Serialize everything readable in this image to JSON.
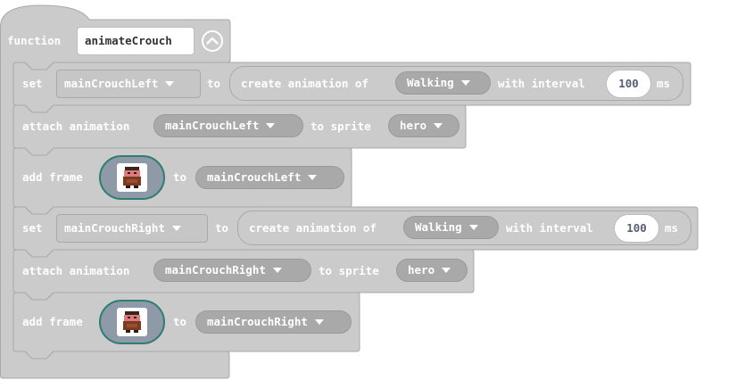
{
  "function_block": {
    "keyword": "function",
    "name": "animateCrouch",
    "collapse_icon": "chevron-up-circle-icon",
    "color": "#cbcbcb"
  },
  "blocks": [
    {
      "set": "set",
      "variable": "mainCrouchLeft",
      "to": "to",
      "create": "create animation of",
      "animation": "Walking",
      "with_interval": "with interval",
      "interval": "100",
      "ms": "ms"
    },
    {
      "attach": "attach animation",
      "animation": "mainCrouchLeft",
      "to_sprite": "to sprite",
      "sprite": "hero"
    },
    {
      "add_frame": "add frame",
      "to": "to",
      "target": "mainCrouchLeft",
      "image_icon": "pixel-hero-crouch-image"
    },
    {
      "set": "set",
      "variable": "mainCrouchRight",
      "to": "to",
      "create": "create animation of",
      "animation": "Walking",
      "with_interval": "with interval",
      "interval": "100",
      "ms": "ms"
    },
    {
      "attach": "attach animation",
      "animation": "mainCrouchRight",
      "to_sprite": "to sprite",
      "sprite": "hero"
    },
    {
      "add_frame": "add frame",
      "to": "to",
      "target": "mainCrouchRight",
      "image_icon": "pixel-hero-crouch-image"
    }
  ],
  "colors": {
    "block": "#cbcbcb",
    "block_border": "#aaaaaa",
    "reporter": "#a9a9a9",
    "image_border": "#2e7d6e",
    "number_text": "#575e75"
  }
}
